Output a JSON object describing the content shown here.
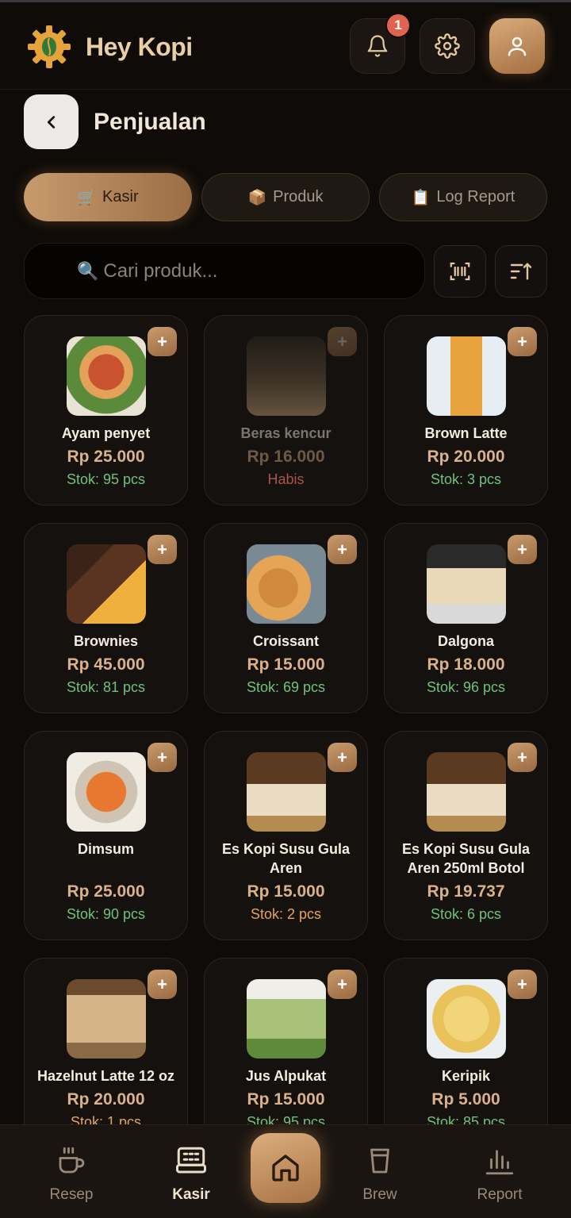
{
  "app": {
    "title": "Hey Kopi",
    "notification_count": "1"
  },
  "page": {
    "title": "Penjualan"
  },
  "tabs": [
    {
      "label": "Kasir",
      "icon": "🛒",
      "active": true
    },
    {
      "label": "Produk",
      "icon": "📦",
      "active": false
    },
    {
      "label": "Log Report",
      "icon": "📋",
      "active": false
    }
  ],
  "search": {
    "icon": "🔍",
    "placeholder": "Cari produk..."
  },
  "products": [
    {
      "name": "Ayam penyet",
      "price": "Rp 25.000",
      "stock": "Stok: 95 pcs",
      "stock_status": "ok"
    },
    {
      "name": "Beras kencur",
      "price": "Rp 16.000",
      "stock": "Habis",
      "stock_status": "out"
    },
    {
      "name": "Brown Latte",
      "price": "Rp 20.000",
      "stock": "Stok: 3 pcs",
      "stock_status": "ok"
    },
    {
      "name": "Brownies",
      "price": "Rp 45.000",
      "stock": "Stok: 81 pcs",
      "stock_status": "ok"
    },
    {
      "name": "Croissant",
      "price": "Rp 15.000",
      "stock": "Stok: 69 pcs",
      "stock_status": "ok"
    },
    {
      "name": "Dalgona",
      "price": "Rp 18.000",
      "stock": "Stok: 96 pcs",
      "stock_status": "ok"
    },
    {
      "name": "Dimsum",
      "price": "Rp 25.000",
      "stock": "Stok: 90 pcs",
      "stock_status": "ok"
    },
    {
      "name": "Es Kopi Susu Gula Aren",
      "price": "Rp 15.000",
      "stock": "Stok: 2 pcs",
      "stock_status": "low"
    },
    {
      "name": "Es Kopi Susu Gula Aren 250ml Botol",
      "price": "Rp 19.737",
      "stock": "Stok: 6 pcs",
      "stock_status": "ok"
    },
    {
      "name": "Hazelnut Latte 12 oz",
      "price": "Rp 20.000",
      "stock": "Stok: 1 pcs",
      "stock_status": "low"
    },
    {
      "name": "Jus Alpukat",
      "price": "Rp 15.000",
      "stock": "Stok: 95 pcs",
      "stock_status": "ok"
    },
    {
      "name": "Keripik",
      "price": "Rp 5.000",
      "stock": "Stok: 85 pcs",
      "stock_status": "ok"
    }
  ],
  "add_label": "+",
  "bottom_nav": [
    {
      "label": "Resep",
      "icon": "coffee-cup-icon"
    },
    {
      "label": "Kasir",
      "icon": "cash-register-icon",
      "active": true
    },
    {
      "label": "Home",
      "icon": "home-icon"
    },
    {
      "label": "Brew",
      "icon": "cup-icon"
    },
    {
      "label": "Report",
      "icon": "bar-chart-icon"
    }
  ],
  "colors": {
    "background": "#0f0b08",
    "accent": "#c79a6c",
    "stock_ok": "#6fc27c",
    "stock_low": "#e6a35b",
    "stock_out": "#a8564a",
    "badge": "#e0634f"
  }
}
